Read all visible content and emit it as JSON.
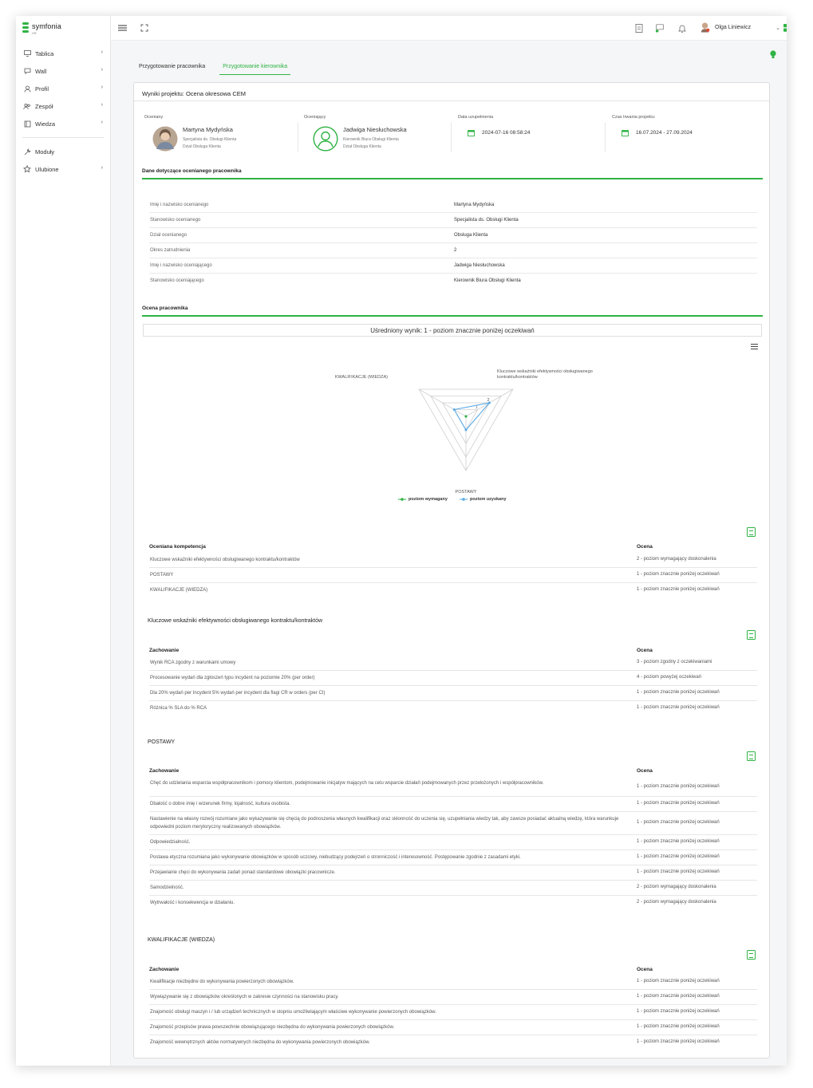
{
  "app": {
    "logo_text": "symfonia",
    "logo_sub": "HR"
  },
  "sidebar": {
    "items": [
      {
        "label": "Tablica",
        "icon": "monitor-icon"
      },
      {
        "label": "Wall",
        "icon": "chat-icon"
      },
      {
        "label": "Profil",
        "icon": "user-icon"
      },
      {
        "label": "Zespół",
        "icon": "team-icon"
      },
      {
        "label": "Wiedza",
        "icon": "book-icon"
      },
      {
        "label": "Moduły",
        "icon": "wrench-icon"
      },
      {
        "label": "Ulubione",
        "icon": "star-icon"
      }
    ]
  },
  "header": {
    "user_name": "Olga Liniewicz"
  },
  "tabs": [
    "Przygotowanie pracownika",
    "Przygotowanie kierownika"
  ],
  "project": {
    "title": "Wyniki projektu: Ocena okresowa CEM",
    "assessed_label": "Oceniany",
    "assessed_name": "Martyna Mydyńska",
    "assessed_position": "Specjalista ds. Obsługi Klienta",
    "assessed_dept": "Dział Obsługa Klienta",
    "assessor_label": "Oceniający",
    "assessor_name": "Jadwiga Niesłuchowska",
    "assessor_position": "Kierownik Biura Obsługi Klienta",
    "assessor_dept": "Dział Obsługa Klienta",
    "completion_label": "Data uzupełnienia",
    "completion_date": "2024-07-16 08:58:24",
    "duration_label": "Czas trwania projektu:",
    "duration_value": "16.07.2024 - 27.09.2024"
  },
  "employee_section": {
    "title": "Dane dotyczące ocenianego pracownika",
    "rows": [
      {
        "k": "Imię i nazwisko ocenianego",
        "v": "Martyna Mydyńska"
      },
      {
        "k": "Stanowisko ocenianego",
        "v": "Specjalista ds. Obsługi Klienta"
      },
      {
        "k": "Dział ocenianego",
        "v": "Obsługa Klienta"
      },
      {
        "k": "Okres zatrudnienia",
        "v": "2"
      },
      {
        "k": "Imię i nazwisko oceniającego",
        "v": "Jadwiga Niesłuchowska"
      },
      {
        "k": "Stanowisko oceniającego",
        "v": "Kierownik Biura Obsługi Klienta"
      }
    ]
  },
  "evaluation": {
    "title": "Ocena pracownika",
    "average": "Uśredniony wynik: 1 - poziom znacznie poniżej oczekiwań"
  },
  "chart_data": {
    "type": "radar",
    "axes": [
      "Kluczowe wskaźniki efektywności obsługiwanego kontraktu/kontraktów",
      "POSTAWY",
      "KWALIFIKACJE (WIEDZA)"
    ],
    "axis_tick_labels": [
      "1",
      "2"
    ],
    "series": [
      {
        "name": "poziom wymagany",
        "color": "#2fb344",
        "values": [
          0,
          0,
          0
        ]
      },
      {
        "name": "poziom uzyskany",
        "color": "#5aa9e6",
        "values": [
          2,
          1,
          1
        ]
      }
    ],
    "legend": "bottom"
  },
  "competence_table": {
    "col1": "Oceniana kompetencja",
    "col2": "Ocena",
    "rows": [
      {
        "c1": "Kluczowe wskaźniki efektywności obsługiwanego kontraktu/kontraktów",
        "c2": "2 - poziom wymagający doskonalenia"
      },
      {
        "c1": "POSTAWY",
        "c2": "1 - poziom znacznie poniżej oczekiwań"
      },
      {
        "c1": "KWALIFIKACJE (WIEDZA)",
        "c2": "1 - poziom znacznie poniżej oczekiwań"
      }
    ]
  },
  "kpi_section": {
    "title": "Kluczowe wskaźniki efektywności obsługiwanego kontraktu/kontraktów",
    "col1": "Zachowanie",
    "col2": "Ocena",
    "rows": [
      {
        "c1": "Wynik RCA zgodny z warunkami umowy",
        "c2": "3 - poziom zgodny z oczekiwaniami"
      },
      {
        "c1": "Procesowanie wydań dla zgłoszeń typu incydent na poziomie 20% (per order)",
        "c2": "4 - poziom powyżej oczekiwań"
      },
      {
        "c1": "Dla 20% wydań per Incydent 5% wydań per incydent dla flagi CR w orders (per CI)",
        "c2": "1 - poziom znacznie poniżej oczekiwań"
      },
      {
        "c1": "Różnica % SLA do % RCA",
        "c2": "1 - poziom znacznie poniżej oczekiwań"
      }
    ]
  },
  "attitudes_section": {
    "title": "POSTAWY",
    "col1": "Zachowanie",
    "col2": "Ocena",
    "rows": [
      {
        "c1": "Chęć do udzielania wsparcia współpracownikom i pomocy klientom, podejmowanie inicjatyw mających na celu wsparcie działań podejmowanych przez przełożonych i współpracowników.",
        "c2": "1 - poziom znacznie poniżej oczekiwań"
      },
      {
        "c1": "Dbałość o dobre imię i wizerunek firmy, lojalność, kultura osobista.",
        "c2": "1 - poziom znacznie poniżej oczekiwań"
      },
      {
        "c1": "Nastawienie na własny rozwój rozumiane jako wykazywanie się chęcią do podnoszenia własnych kwalifikacji oraz skłonność do uczenia się, uzupełniania wiedzy tak, aby zawsze posiadać aktualną wiedzę, która warunkuje odpowiedni poziom merytoryczny realizowanych obowiązków.",
        "c2": "1 - poziom znacznie poniżej oczekiwań"
      },
      {
        "c1": "Odpowiedzialność.",
        "c2": "1 - poziom znacznie poniżej oczekiwań"
      },
      {
        "c1": "Postawa etyczna rozumiana jako wykonywanie obowiązków w sposób uczciwy, niebudzący podejrzeń o stronniczość i interesowność. Postępowanie zgodnie z zasadami etyki.",
        "c2": "1 - poziom znacznie poniżej oczekiwań"
      },
      {
        "c1": "Przejawianie chęci do wykonywania zadań ponad standardowe obowiązki pracownicze.",
        "c2": "1 - poziom znacznie poniżej oczekiwań"
      },
      {
        "c1": "Samodzielność.",
        "c2": "2 - poziom wymagający doskonalenia"
      },
      {
        "c1": "Wytrwałość i konsekwencja w działaniu.",
        "c2": "2 - poziom wymagający doskonalenia"
      }
    ]
  },
  "qualifications_section": {
    "title": "KWALIFIKACJE (WIEDZA)",
    "col1": "Zachowanie",
    "col2": "Ocena",
    "rows": [
      {
        "c1": "Kwalifikacje niezbędne do wykonywania powierzonych obowiązków.",
        "c2": "1 - poziom znacznie poniżej oczekiwań"
      },
      {
        "c1": "Wywiązywanie się z obowiązków określonych w zakresie czynności na stanowisku pracy.",
        "c2": "1 - poziom znacznie poniżej oczekiwań"
      },
      {
        "c1": "Znajomość obsługi maszyn i / lub urządzeń technicznych w stopniu umożliwiającym właściwe wykonywanie powierzonych obowiązków.",
        "c2": "1 - poziom znacznie poniżej oczekiwań"
      },
      {
        "c1": "Znajomość przepisów prawa powszechnie obowiązującego niezbędna do wykonywania powierzonych obowiązków.",
        "c2": "1 - poziom znacznie poniżej oczekiwań"
      },
      {
        "c1": "Znajomość wewnętrznych aktów normatywnych niezbędna do wykonywania powierzonych obowiązków.",
        "c2": "1 - poziom znacznie poniżej oczekiwań"
      }
    ]
  }
}
